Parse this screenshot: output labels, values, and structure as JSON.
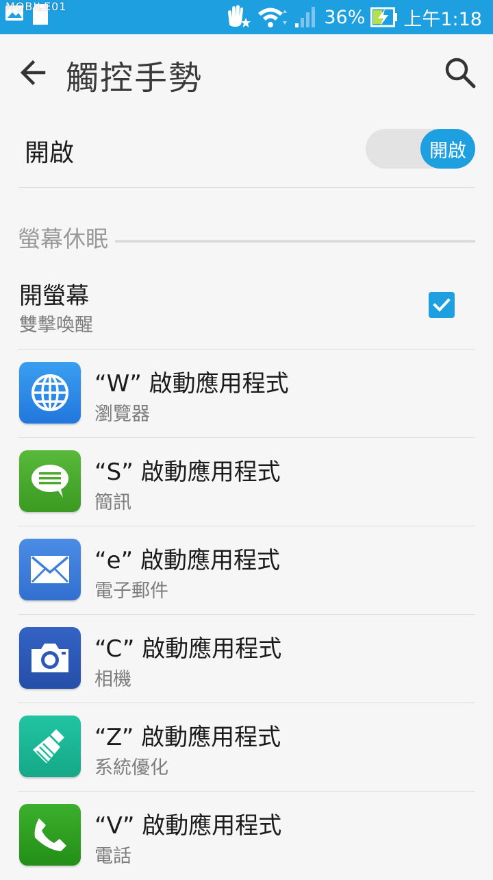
{
  "status_bar": {
    "watermark": "MOBILE01",
    "battery_percent": "36%",
    "time": "上午1:18",
    "color": "#1e9fe0"
  },
  "app_bar": {
    "title": "觸控手勢"
  },
  "master_switch": {
    "label": "開啟",
    "toggle_label": "開啟",
    "on": true
  },
  "section": {
    "title": "螢幕休眠"
  },
  "wake": {
    "title": "開螢幕",
    "subtitle": "雙擊喚醒",
    "checked": true
  },
  "apps": [
    {
      "title": "“W” 啟動應用程式",
      "subtitle": "瀏覽器",
      "icon": "globe-icon",
      "color": "#2f8ee8"
    },
    {
      "title": "“S” 啟動應用程式",
      "subtitle": "簡訊",
      "icon": "message-icon",
      "color": "#4caa2f"
    },
    {
      "title": "“e” 啟動應用程式",
      "subtitle": "電子郵件",
      "icon": "envelope-icon",
      "color": "#3f7fdc"
    },
    {
      "title": "“C” 啟動應用程式",
      "subtitle": "相機",
      "icon": "camera-icon",
      "color": "#2d58b8"
    },
    {
      "title": "“Z” 啟動應用程式",
      "subtitle": "系統優化",
      "icon": "broom-icon",
      "color": "#1dbc9a"
    },
    {
      "title": "“V” 啟動應用程式",
      "subtitle": "電話",
      "icon": "phone-icon",
      "color": "#2ea323"
    }
  ]
}
